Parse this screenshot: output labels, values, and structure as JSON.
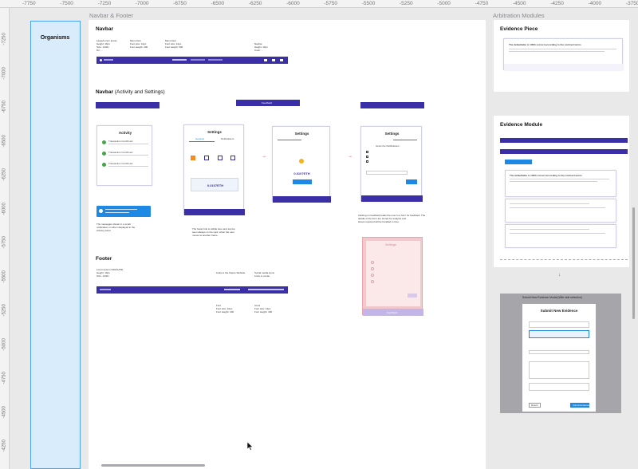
{
  "ruler": {
    "top": [
      "-7750",
      "-7500",
      "-7250",
      "-7000",
      "-6750",
      "-6500",
      "-6250",
      "-6000",
      "-5750",
      "-5500",
      "-5250",
      "-5000",
      "-4750",
      "-4500",
      "-4250",
      "-4000",
      "-3750"
    ],
    "left": [
      "-7250",
      "-7000",
      "-6750",
      "-6500",
      "-6250",
      "-6000",
      "-5750",
      "-5500",
      "-5250",
      "-5000",
      "-4750",
      "-4500",
      "-4250"
    ]
  },
  "frames": {
    "organisms_title": "Organisms",
    "navbar_footer_label": "Navbar & Footer",
    "arbitration_label": "Arbitration Modules"
  },
  "navbar_section": {
    "title": "Navbar",
    "title2_bold": "Navbar",
    "title2_light": "(Activity and Settings)",
    "footer_title": "Footer",
    "activity_title": "Activity",
    "settings_title": "Settings",
    "general_tab": "General",
    "notifications_tab": "Notifications",
    "transaction_confirmed": "Transaction Confirmed",
    "feedback": "Feedback",
    "grant_title": "Grant the Notifications",
    "amount": "0.0107ETH",
    "claimed": "0.0107ETH"
  },
  "evidence": {
    "piece_title": "Evidence Piece",
    "module_title": "Evidence Module",
    "submit_frame_label": "Submit New Evidence Modal (With side selection)",
    "submit_modal_title": "Submit New Evidence",
    "submit_button": "Submit Evidence",
    "return_button": "Return",
    "evidence_heading": "The defaultable is 100% correct according to the contract terms"
  }
}
